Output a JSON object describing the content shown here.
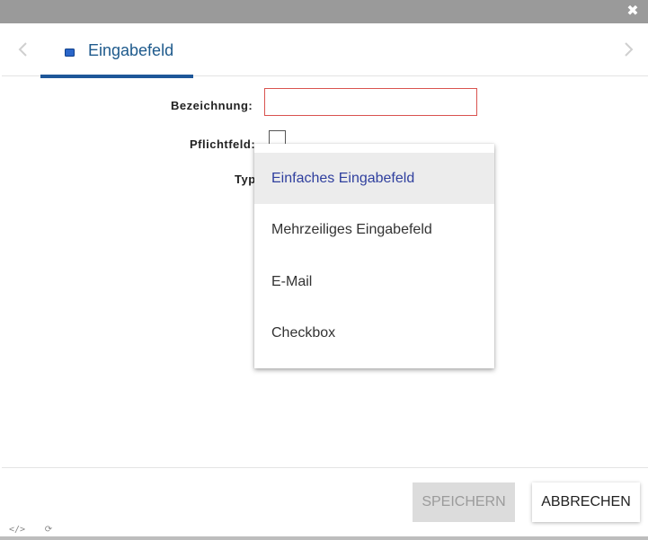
{
  "window": {
    "close_glyph": "✖",
    "close_icon": "close-icon"
  },
  "tabs": [
    {
      "label": "Eingabefeld",
      "icon": "input-field-icon",
      "active": true
    }
  ],
  "form": {
    "bezeichnung_label": "Bezeichnung:",
    "bezeichnung_value": "",
    "pflichtfeld_label": "Pflichtfeld:",
    "pflichtfeld_checked": false,
    "typ_label": "Typ:"
  },
  "type_dropdown": {
    "options": [
      {
        "label": "Einfaches Eingabefeld",
        "selected": true
      },
      {
        "label": "Mehrzeiliges Eingabefeld",
        "selected": false
      },
      {
        "label": "E-Mail",
        "selected": false
      },
      {
        "label": "Checkbox",
        "selected": false
      }
    ]
  },
  "footer": {
    "save_label": "SPEICHERN",
    "cancel_label": "ABBRECHEN"
  },
  "bottom_icons": {
    "code_glyph": "</>",
    "refresh_glyph": "⟳"
  },
  "colors": {
    "accent": "#1e5799",
    "tab_text": "#1e5a8c",
    "error_border": "#d9534f",
    "selected_option_text": "#2f3f9e",
    "selected_option_bg": "#ececec"
  }
}
